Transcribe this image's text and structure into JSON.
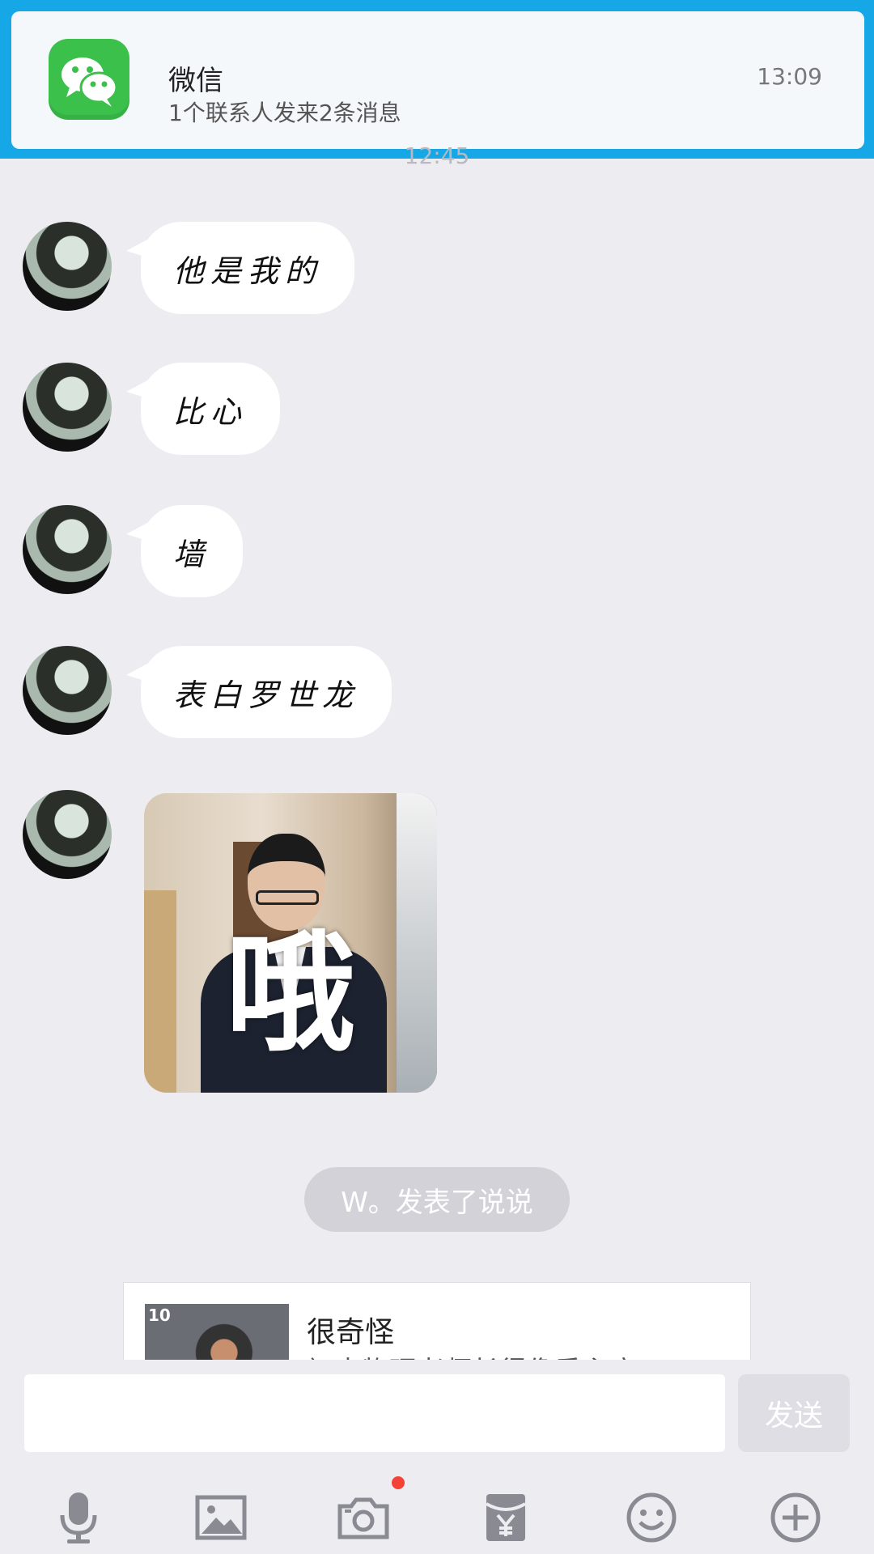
{
  "notification": {
    "app_name": "微信",
    "message": "1个联系人发来2条消息",
    "time": "13:09",
    "icon": "wechat-icon"
  },
  "chat": {
    "timestamp_peek": "12:45",
    "messages": [
      {
        "type": "text",
        "text": "他是我的"
      },
      {
        "type": "text",
        "text": "比心"
      },
      {
        "type": "text",
        "text": "墙"
      },
      {
        "type": "text",
        "text": "表白罗世龙"
      },
      {
        "type": "image",
        "caption": "哦"
      }
    ],
    "system_notice": "W。发表了说说",
    "shared_post": {
      "badge": "10",
      "title": "很奇怪",
      "subtitle": "初中物理老师长得像秃主席"
    }
  },
  "input": {
    "placeholder": "",
    "send_label": "发送"
  },
  "toolbar": {
    "items": [
      "microphone-icon",
      "image-icon",
      "camera-icon",
      "red-packet-icon",
      "emoji-icon",
      "plus-icon"
    ],
    "camera_badge": true
  },
  "colors": {
    "banner": "#15a7e6",
    "background": "#ececf1",
    "wechat_green": "#3bc04b",
    "icon_gray": "#8a8a93",
    "badge_red": "#f44336"
  }
}
